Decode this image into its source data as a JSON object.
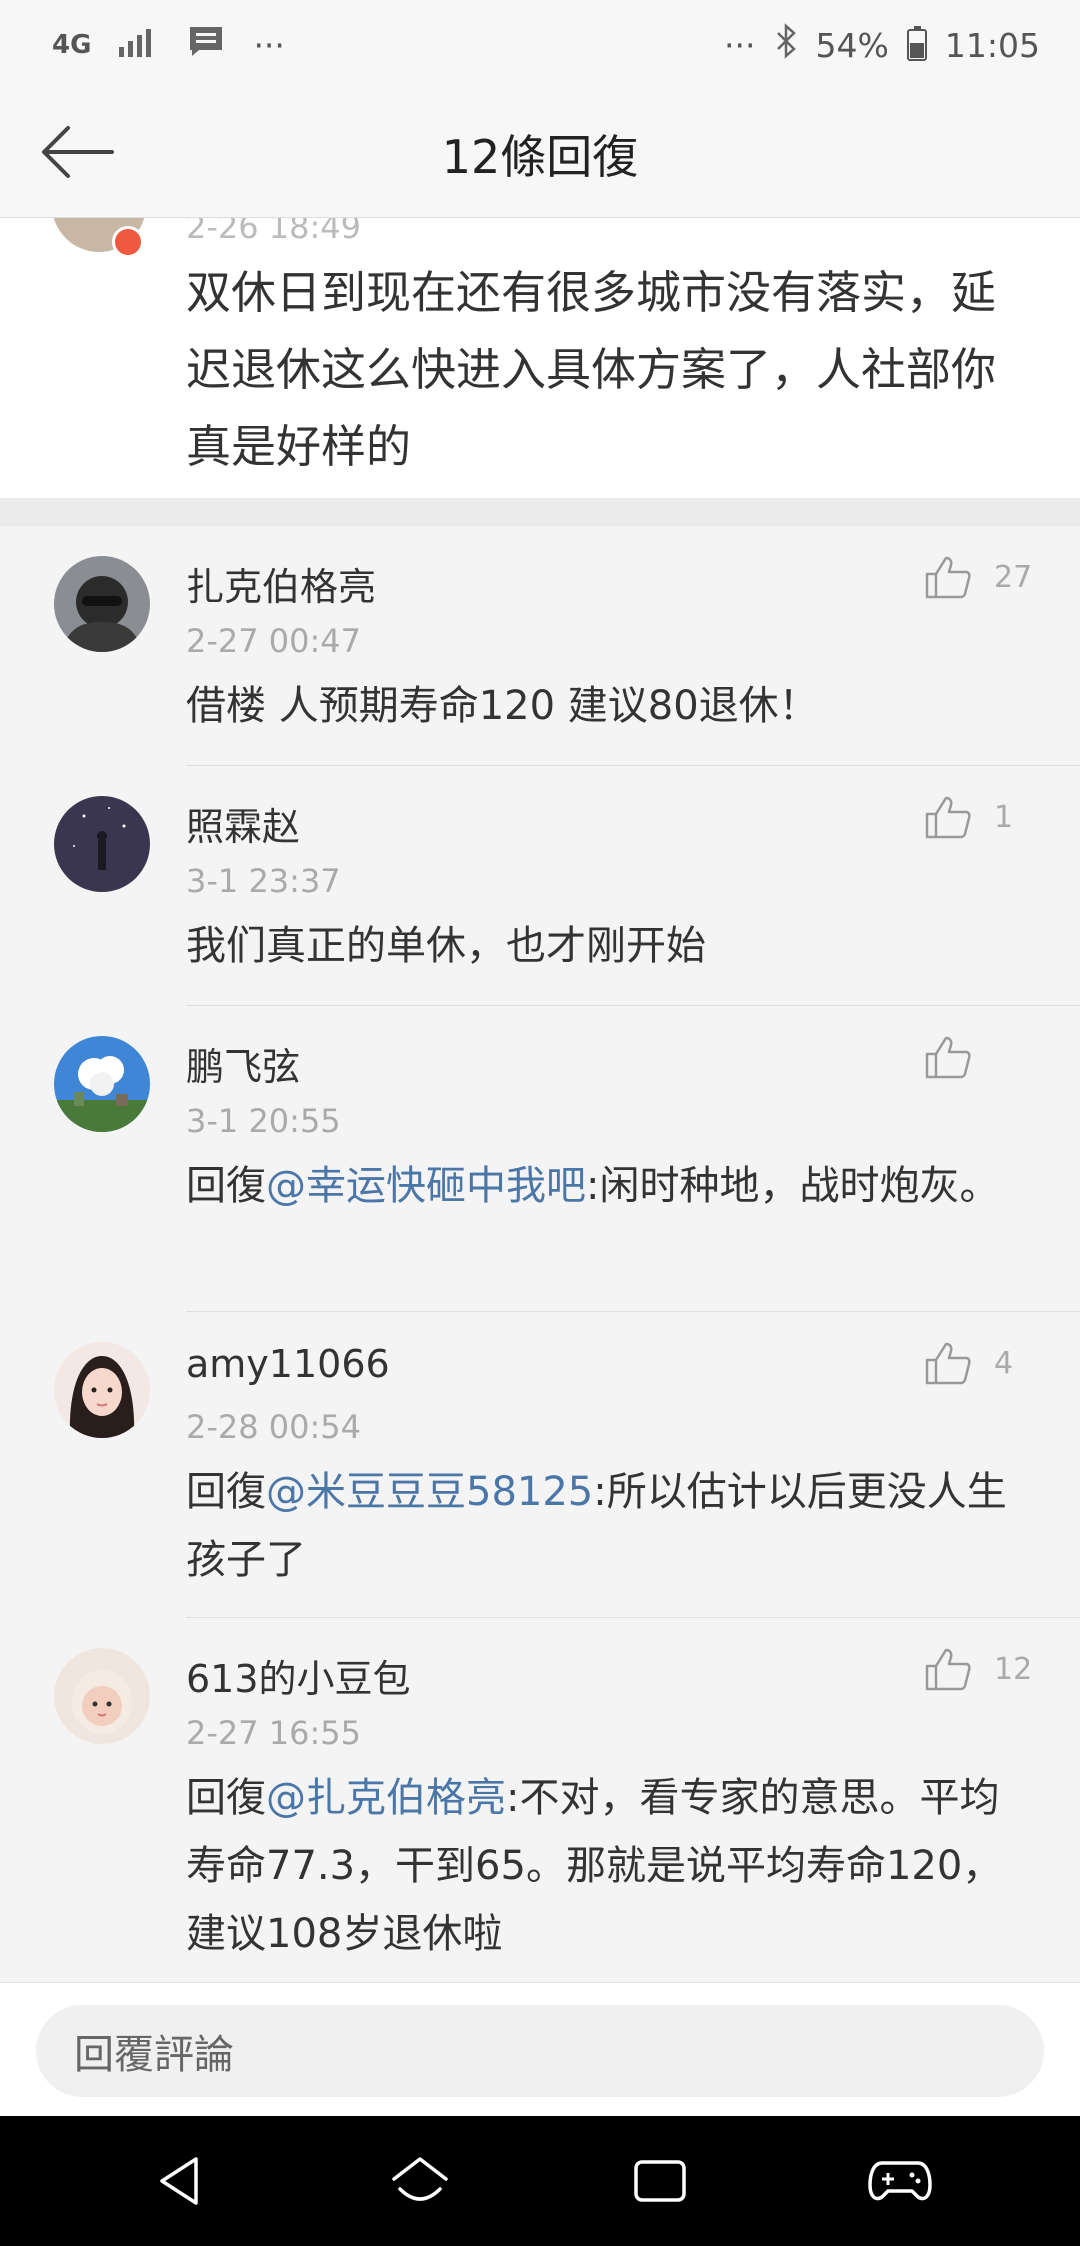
{
  "status_bar": {
    "network": "4G",
    "dots_left": "···",
    "dots_right": "···",
    "battery": "54%",
    "time": "11:05"
  },
  "header": {
    "title": "12條回復"
  },
  "original_post": {
    "time": "2-26 18:49",
    "text": "双休日到现在还有很多城市没有落实，延迟退休这么快进入具体方案了，人社部你真是好样的"
  },
  "comments": [
    {
      "name": "扎克伯格亮",
      "time": "2-27 00:47",
      "likes": "27",
      "text": "借楼 人预期寿命120 建议80退休！"
    },
    {
      "name": "照霖赵",
      "time": "3-1 23:37",
      "likes": "1",
      "text": "我们真正的单休，也才刚开始"
    },
    {
      "name": "鹏飞弦",
      "time": "3-1 20:55",
      "likes": "",
      "reply_prefix": "回復",
      "mention": "@幸运快砸中我吧",
      "text": ":闲时种地，战时炮灰。"
    },
    {
      "name": "amy11066",
      "time": "2-28 00:54",
      "likes": "4",
      "reply_prefix": "回復",
      "mention": "@米豆豆豆58125",
      "text": ":所以估计以后更没人生孩子了"
    },
    {
      "name": "613的小豆包",
      "time": "2-27 16:55",
      "likes": "12",
      "reply_prefix": "回復",
      "mention": "@扎克伯格亮",
      "text": ":不对，看专家的意思。平均寿命77.3，干到65。那就是说平均寿命120，建议108岁退休啦"
    }
  ],
  "reply_box": {
    "placeholder": "回覆評論"
  },
  "colors": {
    "mention": "#4a76a8",
    "background": "#f4f4f4"
  }
}
